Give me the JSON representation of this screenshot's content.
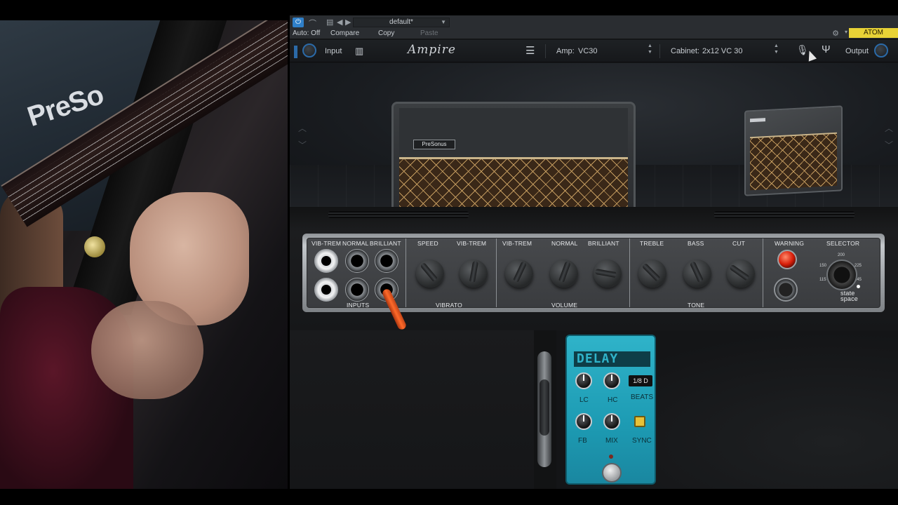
{
  "plugin": {
    "topbar": {
      "auto_off": "Auto: Off",
      "compare": "Compare",
      "copy": "Copy",
      "paste": "Paste",
      "preset": "default*",
      "device": "ATOM"
    },
    "controls": {
      "input_label": "Input",
      "logo": "Ampire",
      "amp_label": "Amp:",
      "amp_value": "VC30",
      "cabinet_label": "Cabinet:",
      "cabinet_value": "2x12 VC 30",
      "output_label": "Output"
    },
    "amp_badge": "PreSonus",
    "panel": {
      "jack_labels": [
        "VIB-TREM",
        "NORMAL",
        "BRILLIANT"
      ],
      "inputs": "INPUTS",
      "vibrato_knobs": [
        "SPEED",
        "VIB-TREM"
      ],
      "vibrato": "VIBRATO",
      "volume_knobs": [
        "VIB-TREM",
        "NORMAL",
        "BRILLIANT"
      ],
      "volume": "VOLUME",
      "tone_knobs": [
        "TREBLE",
        "BASS",
        "CUT"
      ],
      "tone": "TONE",
      "warning": "WARNING",
      "selector": "SELECTOR",
      "selector_values": [
        "150",
        "200",
        "225",
        "115",
        "245"
      ],
      "brand_1": "state",
      "brand_2": "space"
    },
    "pedal": {
      "title": "DELAY",
      "beats_value": "1/8 D",
      "lc": "LC",
      "hc": "HC",
      "beats": "BEATS",
      "fb": "FB",
      "mix": "MIX",
      "sync": "SYNC"
    }
  },
  "video": {
    "shirt_text": "PreSo"
  }
}
